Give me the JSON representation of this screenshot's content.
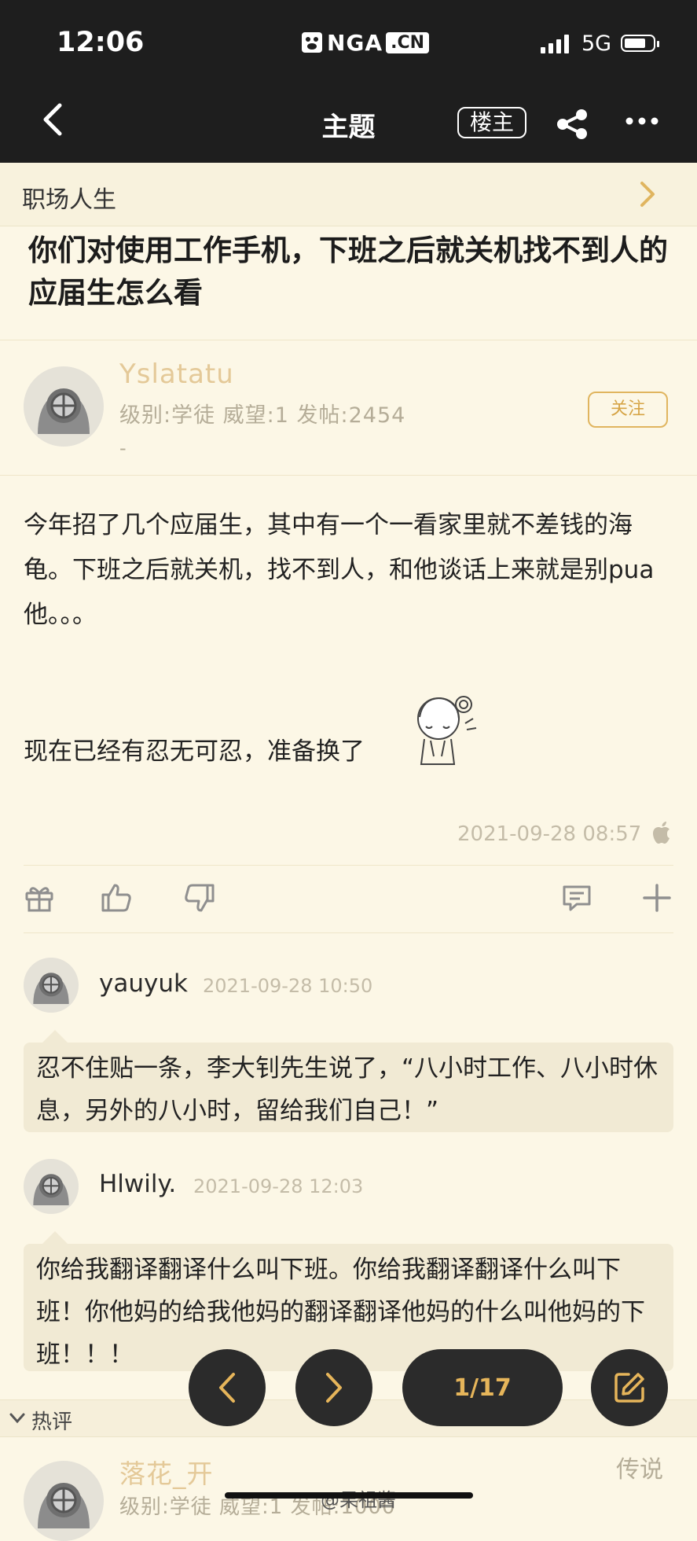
{
  "status_bar": {
    "time": "12:06",
    "network": "5G"
  },
  "logo": {
    "part1": "NGA",
    "part2": ".CN"
  },
  "nav": {
    "title": "主题",
    "op_filter_label": "楼主"
  },
  "category": {
    "label": "职场人生"
  },
  "thread": {
    "title": "你们对使用工作手机，下班之后就关机找不到人的应届生怎么看"
  },
  "op": {
    "username": "Yslatatu",
    "meta": "级别:学徒   威望:1   发帖:2454",
    "sub": "-",
    "follow_label": "关注",
    "body": "今年招了几个应届生，其中有一个一看家里就不差钱的海龟。下班之后就关机，找不到人，和他谈话上来就是别pua他。。。",
    "body2": "现在已经有忍无可忍，准备换了",
    "date": "2021-09-28 08:57"
  },
  "replies": [
    {
      "username": "yauyuk",
      "date": "2021-09-28 10:50",
      "text": "忍不住贴一条，李大钊先生说了，“八小时工作、八小时休息，另外的八小时，留给我们自己！”"
    },
    {
      "username": "Hlwily.",
      "date": "2021-09-28 12:03",
      "text": "你给我翻译翻译什么叫下班。你给我翻译翻译什么叫下班！你他妈的给我他妈的翻译翻译他妈的什么叫他妈的下班！！！"
    }
  ],
  "hot": {
    "label": "热评",
    "username": "落花_开",
    "rank": "传说",
    "meta": "级别:学徒   威望:1   发帖:1000"
  },
  "pager": {
    "indicator": "1/17"
  },
  "watermark": "@果祖酱"
}
